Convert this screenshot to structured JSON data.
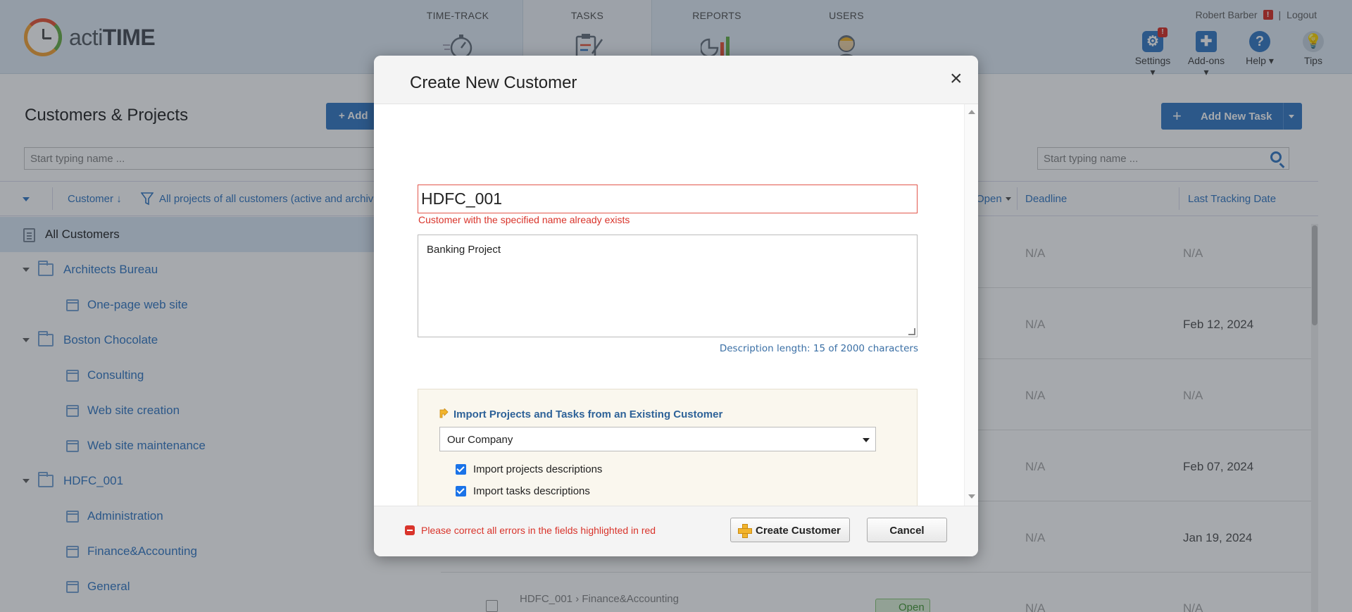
{
  "app": {
    "logo_text_prefix": "acti",
    "logo_text_suffix": "TIME"
  },
  "nav": [
    {
      "label": "TIME-TRACK"
    },
    {
      "label": "TASKS"
    },
    {
      "label": "REPORTS"
    },
    {
      "label": "USERS"
    }
  ],
  "user": {
    "name": "Robert Barber",
    "warning": "!",
    "separator": "|",
    "logout": "Logout"
  },
  "tools": {
    "settings": "Settings",
    "addons": "Add-ons",
    "help": "Help",
    "tips": "Tips",
    "settings_badge": "!"
  },
  "left": {
    "title": "Customers & Projects",
    "add_button": "Add",
    "search_placeholder": "Start typing name ...",
    "col_customer": "Customer",
    "filter_label": "All projects of all customers (active and archived)",
    "tree": [
      {
        "type": "all",
        "label": "All Customers"
      },
      {
        "type": "customer",
        "label": "Architects Bureau"
      },
      {
        "type": "project",
        "label": "One-page web site"
      },
      {
        "type": "customer",
        "label": "Boston Chocolate"
      },
      {
        "type": "project",
        "label": "Consulting"
      },
      {
        "type": "project",
        "label": "Web site creation"
      },
      {
        "type": "project",
        "label": "Web site maintenance"
      },
      {
        "type": "customer",
        "label": "HDFC_001"
      },
      {
        "type": "project",
        "label": "Administration"
      },
      {
        "type": "project",
        "label": "Finance&Accounting"
      },
      {
        "type": "project",
        "label": "General"
      }
    ]
  },
  "right": {
    "add_task": "Add New Task",
    "search_placeholder": "Start typing name ...",
    "col_open": "Open",
    "col_deadline": "Deadline",
    "col_last_tracking": "Last Tracking Date",
    "rows": [
      {
        "deadline": "N/A",
        "last": "N/A"
      },
      {
        "deadline": "N/A",
        "last": "Feb 12, 2024"
      },
      {
        "deadline": "N/A",
        "last": "N/A"
      },
      {
        "deadline": "N/A",
        "last": "Feb 07, 2024"
      },
      {
        "deadline": "N/A",
        "last": "Jan 19, 2024"
      }
    ],
    "partial_row": {
      "path_customer": "HDFC_001",
      "path_project": "Finance&Accounting",
      "status": "Open",
      "deadline": "N/A",
      "last": "N/A"
    }
  },
  "modal": {
    "title": "Create New Customer",
    "close": "×",
    "name_value": "HDFC_001",
    "name_error": "Customer with the specified name already exists",
    "description_value": "Banking Project",
    "description_length": "Description length: 15 of 2000 characters",
    "import_title": "Import Projects and Tasks from an Existing Customer",
    "import_select_value": "Our Company",
    "chk_projects": "Import projects descriptions",
    "chk_tasks": "Import tasks descriptions",
    "footer_error": "Please correct all errors in the fields highlighted in red",
    "create_button": "Create Customer",
    "cancel_button": "Cancel"
  },
  "colors": {
    "accent": "#3a7cc5",
    "error": "#d9342b",
    "header_bg": "#e2ecf5"
  }
}
